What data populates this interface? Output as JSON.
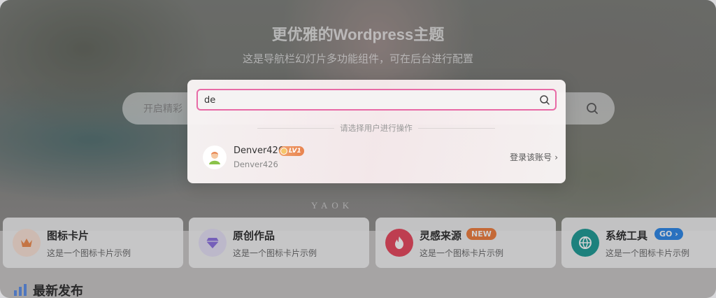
{
  "hero": {
    "title": "更优雅的Wordpress主题",
    "subtitle": "这是导航栏幻灯片多功能组件，可在后台进行配置",
    "search_placeholder": "开启精彩",
    "watermark": "YAOK"
  },
  "cards": [
    {
      "title": "图标卡片",
      "desc": "这是一个图标卡片示例",
      "icon": "crown-icon",
      "icon_color": "#f08a4b",
      "badge": ""
    },
    {
      "title": "原创作品",
      "desc": "这是一个图标卡片示例",
      "icon": "gem-icon",
      "icon_color": "#8b6fe0",
      "badge": ""
    },
    {
      "title": "灵感来源",
      "desc": "这是一个图标卡片示例",
      "icon": "flame-icon",
      "icon_color": "#e8455a",
      "badge": "NEW",
      "badge_color": "#f07c3a"
    },
    {
      "title": "系统工具",
      "desc": "这是一个图标卡片示例",
      "icon": "globe-icon",
      "icon_color": "#1a9a94",
      "badge": "GO",
      "badge_color": "#2a86e8"
    }
  ],
  "section": {
    "latest_title": "最新发布"
  },
  "modal": {
    "input_value": "de",
    "hint": "请选择用户进行操作",
    "user": {
      "name": "Denver426",
      "level": "LV1",
      "sub": "Denver426",
      "action": "登录该账号"
    }
  }
}
